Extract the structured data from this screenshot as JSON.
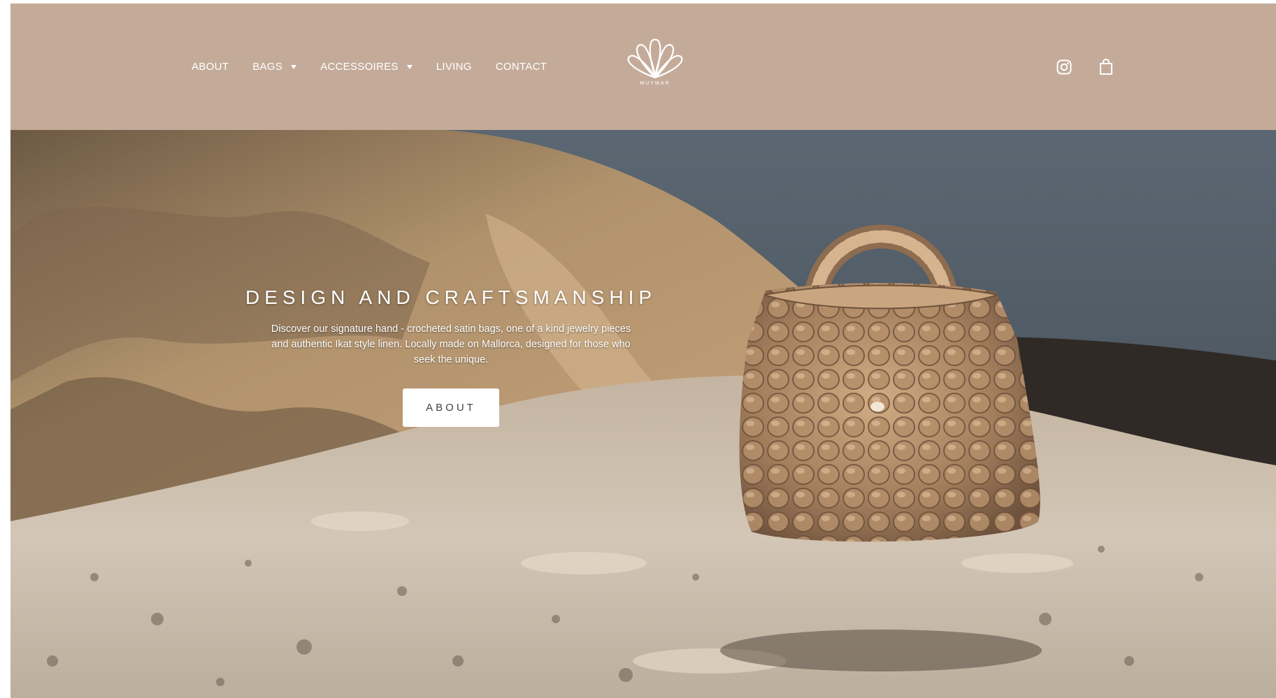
{
  "brand": {
    "logo_text": "MUYMAR",
    "header_color": "#c4ab99"
  },
  "nav": {
    "items": [
      {
        "label": "ABOUT",
        "has_dropdown": false
      },
      {
        "label": "BAGS",
        "has_dropdown": true
      },
      {
        "label": "ACCESSOIRES",
        "has_dropdown": true
      },
      {
        "label": "LIVING",
        "has_dropdown": false
      },
      {
        "label": "CONTACT",
        "has_dropdown": false
      }
    ]
  },
  "header_icons": [
    "instagram-icon",
    "shopping-bag-icon"
  ],
  "hero": {
    "title": "DESIGN AND CRAFTSMANSHIP",
    "subtitle": "Discover our signature hand - crocheted satin bags, one of a kind jewelry pieces and authentic Ikat style linen. Locally made on Mallorca, designed for those who seek the unique.",
    "button_label": "ABOUT"
  }
}
